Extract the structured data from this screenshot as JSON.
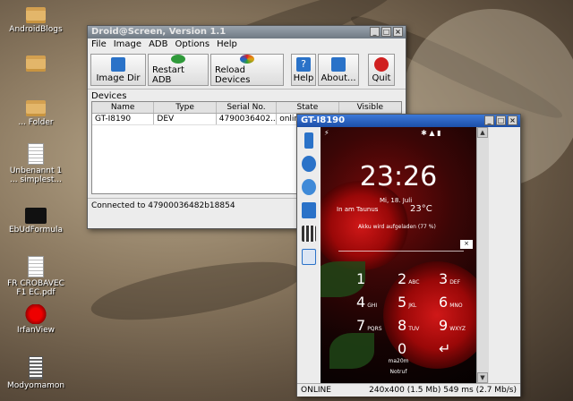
{
  "desktop": {
    "icons": [
      {
        "label": "AndroidBlogs",
        "type": "folder"
      },
      {
        "label": "",
        "type": "folder"
      },
      {
        "label": "... Folder",
        "type": "folder"
      },
      {
        "label": "Unbenannt 1 ... simplest...",
        "type": "doc"
      },
      {
        "label": "EbUdFormula",
        "type": "dark"
      },
      {
        "label": "FR CROBAVEC F1 EC.pdf",
        "type": "doc"
      },
      {
        "label": "IrfanView",
        "type": "splat"
      },
      {
        "label": "Modyomamon",
        "type": "bars"
      }
    ]
  },
  "main_window": {
    "title": "Droid@Screen, Version 1.1",
    "menu": [
      "File",
      "Image",
      "ADB",
      "Options",
      "Help"
    ],
    "toolbar": [
      {
        "label": "Image Dir",
        "icon": "folder-icon",
        "color": "#2a72c8"
      },
      {
        "label": "Restart ADB",
        "icon": "refresh-icon",
        "color": "#2f9a3a"
      },
      {
        "label": "Reload Devices",
        "icon": "reload-icon",
        "color": "#e0a010"
      },
      {
        "label": "Help",
        "icon": "help-icon",
        "color": "#2a72c8"
      },
      {
        "label": "About...",
        "icon": "about-icon",
        "color": "#2a72c8"
      },
      {
        "label": "Quit",
        "icon": "quit-icon",
        "color": "#d02020"
      }
    ],
    "devices_label": "Devices",
    "columns": [
      "Name",
      "Type",
      "Serial No.",
      "State",
      "Visible"
    ],
    "rows": [
      {
        "name": "GT-I8190",
        "type": "DEV",
        "serial": "4790036402...",
        "state": "online",
        "visible": ""
      }
    ],
    "status": "Connected to 47900036482b18854"
  },
  "phone_window": {
    "title": "GT-I8190",
    "tools": [
      "phone-icon",
      "rotate-icon",
      "zoom-icon",
      "camera-icon",
      "video-icon",
      "document-icon"
    ],
    "screen": {
      "time": "23:26",
      "date": "Mi, 18. Juli",
      "location": "In am Taunus",
      "temp": "23°C",
      "charging": "Akku wird aufgeladen (77 %)",
      "keys": [
        {
          "n": "1",
          "l": ""
        },
        {
          "n": "2",
          "l": "ABC"
        },
        {
          "n": "3",
          "l": "DEF"
        },
        {
          "n": "4",
          "l": "GHI"
        },
        {
          "n": "5",
          "l": "JKL"
        },
        {
          "n": "6",
          "l": "MNO"
        },
        {
          "n": "7",
          "l": "PQRS"
        },
        {
          "n": "8",
          "l": "TUV"
        },
        {
          "n": "9",
          "l": "WXYZ"
        },
        {
          "n": "",
          "l": ""
        },
        {
          "n": "0",
          "l": ""
        },
        {
          "n": "↵",
          "l": ""
        }
      ],
      "bottom1": "ma20m",
      "bottom2": "Notruf"
    },
    "status_left": "ONLINE",
    "status_right": "240x400 (1.5 Mb) 549 ms (2.7 Mb/s)"
  }
}
